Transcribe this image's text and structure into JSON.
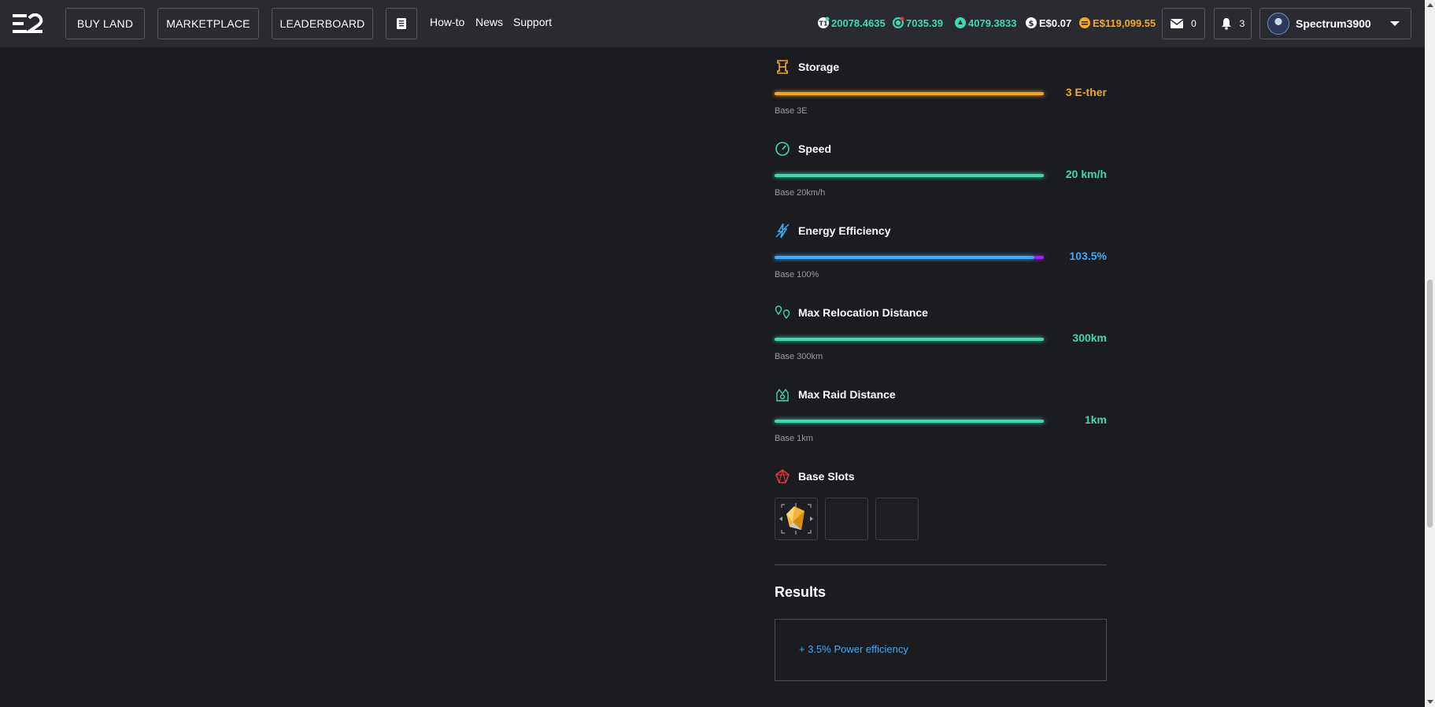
{
  "nav": {
    "buy_land": "BUY LAND",
    "marketplace": "MARKETPLACE",
    "leaderboard": "LEADERBOARD",
    "howto": "How-to",
    "news": "News",
    "support": "Support"
  },
  "balances": [
    {
      "icon": "tile-icon",
      "value": "20078.4635",
      "color": "#3fd8b2"
    },
    {
      "icon": "essence-icon",
      "value": "7035.39",
      "color": "#3fd8b2"
    },
    {
      "icon": "ether-icon",
      "value": "4079.3833",
      "color": "#3fd8b2"
    },
    {
      "icon": "dollar-icon",
      "value": "E$0.07",
      "color": "#ffffff"
    },
    {
      "icon": "coin-icon",
      "value": "E$119,099.55",
      "color": "#f5a623"
    }
  ],
  "mail": {
    "count": "0"
  },
  "notifications": {
    "count": "3"
  },
  "user": {
    "name": "Spectrum3900"
  },
  "stats": [
    {
      "title": "Storage",
      "value": "3 E-ther",
      "base": "Base 3E",
      "color": "#f5a623",
      "fill": 1.0
    },
    {
      "title": "Speed",
      "value": "20 km/h",
      "base": "Base 20km/h",
      "color": "#3fd8b2",
      "fill": 1.0
    },
    {
      "title": "Energy Efficiency",
      "value": "103.5%",
      "base": "Base 100%",
      "color": "#3fa9f5",
      "fill": 1.0
    },
    {
      "title": "Max Relocation Distance",
      "value": "300km",
      "base": "Base 300km",
      "color": "#3fd8b2",
      "fill": 1.0
    },
    {
      "title": "Max Raid Distance",
      "value": "1km",
      "base": "Base 1km",
      "color": "#3fd8b2",
      "fill": 1.0
    }
  ],
  "base_slots": {
    "title": "Base Slots"
  },
  "results": {
    "title": "Results",
    "items": [
      "+ 3.5% Power efficiency"
    ]
  }
}
